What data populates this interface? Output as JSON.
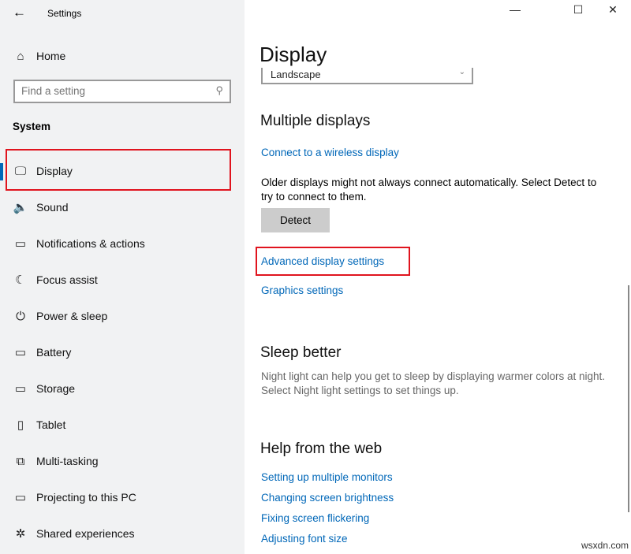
{
  "window": {
    "title": "Settings",
    "back_icon": "arrow-left-icon",
    "minimize": "—",
    "maximize": "☐",
    "close": "✕"
  },
  "sidebar": {
    "home": "Home",
    "search_placeholder": "Find a setting",
    "section": "System",
    "items": [
      {
        "label": "Display",
        "icon": "monitor-icon",
        "glyph": "🖵"
      },
      {
        "label": "Sound",
        "icon": "speaker-icon",
        "glyph": "🔈"
      },
      {
        "label": "Notifications & actions",
        "icon": "notification-icon",
        "glyph": "▭"
      },
      {
        "label": "Focus assist",
        "icon": "moon-icon",
        "glyph": "☾"
      },
      {
        "label": "Power & sleep",
        "icon": "power-icon",
        "glyph": "⏻"
      },
      {
        "label": "Battery",
        "icon": "battery-icon",
        "glyph": "▭"
      },
      {
        "label": "Storage",
        "icon": "storage-icon",
        "glyph": "▭"
      },
      {
        "label": "Tablet",
        "icon": "tablet-icon",
        "glyph": "▯"
      },
      {
        "label": "Multi-tasking",
        "icon": "multitasking-icon",
        "glyph": "⧉"
      },
      {
        "label": "Projecting to this PC",
        "icon": "projecting-icon",
        "glyph": "▭"
      },
      {
        "label": "Shared experiences",
        "icon": "shared-icon",
        "glyph": "✲"
      }
    ],
    "selected_index": 0
  },
  "main": {
    "title": "Display",
    "orientation_value": "Landscape",
    "multiple": {
      "heading": "Multiple displays",
      "wireless_link": "Connect to a wireless display",
      "description": "Older displays might not always connect automatically. Select Detect to try to connect to them.",
      "detect_button": "Detect",
      "advanced_link": "Advanced display settings",
      "graphics_link": "Graphics settings"
    },
    "sleep": {
      "heading": "Sleep better",
      "description": "Night light can help you get to sleep by displaying warmer colors at night. Select Night light settings to set things up."
    },
    "help": {
      "heading": "Help from the web",
      "links": [
        "Setting up multiple monitors",
        "Changing screen brightness",
        "Fixing screen flickering",
        "Adjusting font size"
      ]
    }
  },
  "watermark": "wsxdn.com",
  "colors": {
    "accent": "#0067b8",
    "highlight": "#e0141e"
  }
}
